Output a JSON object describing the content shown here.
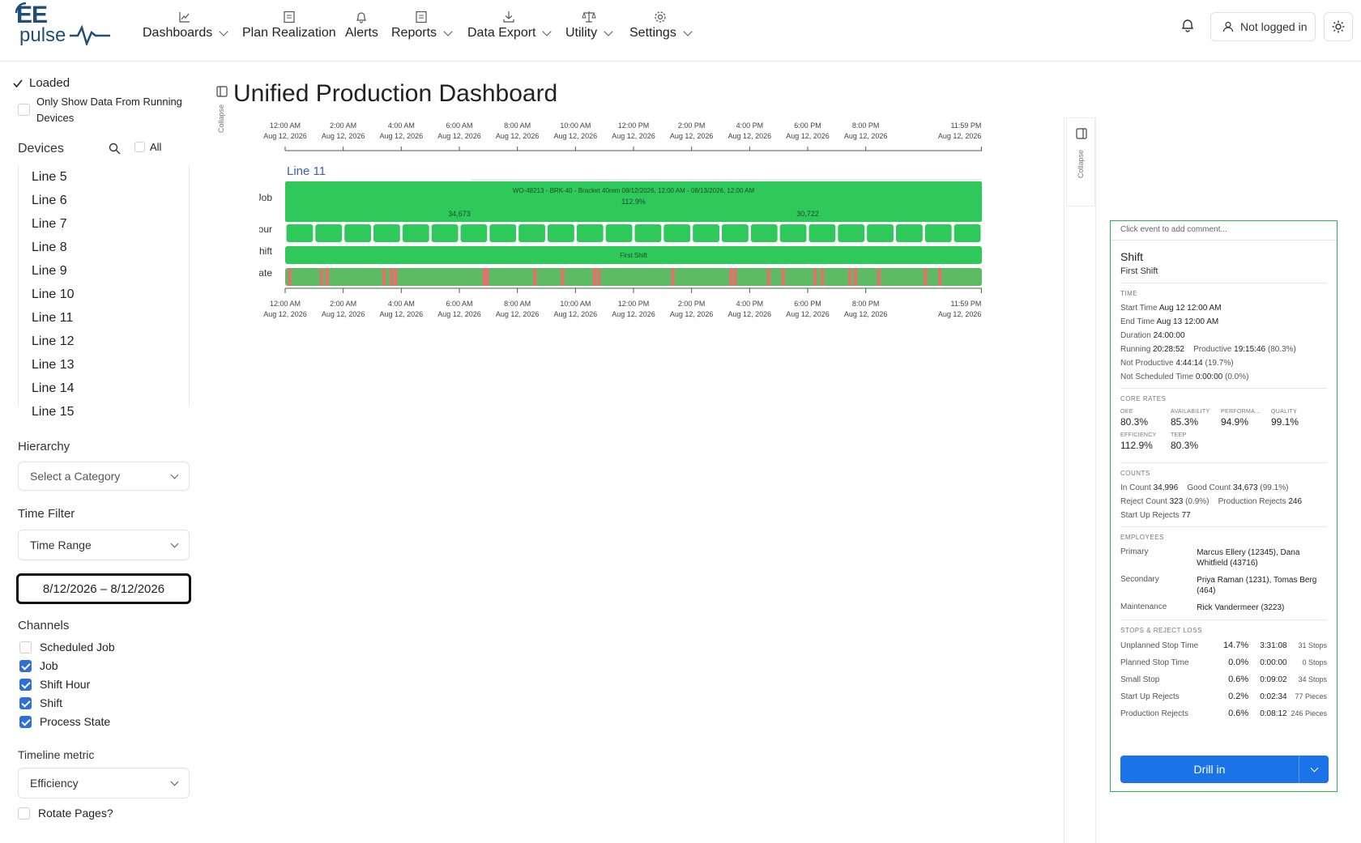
{
  "brand": {
    "line1": "EE",
    "line2": "pulse"
  },
  "nav": {
    "items": [
      {
        "label": "Dashboards",
        "icon": "chart-line-icon",
        "dropdown": true
      },
      {
        "label": "Plan Realization",
        "icon": "document-icon",
        "dropdown": false
      },
      {
        "label": "Alerts",
        "icon": "bell-icon",
        "dropdown": false
      },
      {
        "label": "Reports",
        "icon": "document-icon",
        "dropdown": true
      },
      {
        "label": "Data Export",
        "icon": "download-icon",
        "dropdown": true
      },
      {
        "label": "Utility",
        "icon": "scale-icon",
        "dropdown": true
      },
      {
        "label": "Settings",
        "icon": "gear-icon",
        "dropdown": true
      }
    ],
    "login_label": "Not logged in"
  },
  "sidebar": {
    "loaded_label": "Loaded",
    "running_label": "Only Show Data From Running Devices",
    "devices_title": "Devices",
    "all_label": "All",
    "devices": [
      "Line 5",
      "Line 6",
      "Line 7",
      "Line 8",
      "Line 9",
      "Line 10",
      "Line 11",
      "Line 12",
      "Line 13",
      "Line 14",
      "Line 15"
    ],
    "hierarchy_title": "Hierarchy",
    "hierarchy_placeholder": "Select a Category",
    "time_filter_title": "Time Filter",
    "time_filter_value": "Time Range",
    "date_range": "8/12/2026 – 8/12/2026",
    "channels_title": "Channels",
    "channels": [
      {
        "label": "Scheduled Job",
        "checked": false
      },
      {
        "label": "Job",
        "checked": true
      },
      {
        "label": "Shift Hour",
        "checked": true
      },
      {
        "label": "Shift",
        "checked": true
      },
      {
        "label": "Process State",
        "checked": true
      }
    ],
    "timeline_metric_title": "Timeline metric",
    "timeline_metric_value": "Efficiency",
    "rotate_label": "Rotate Pages?"
  },
  "main": {
    "collapse_label": "Collapse",
    "title": "Unified Production Dashboard"
  },
  "chart_data": {
    "type": "timeline",
    "line_name": "Line 11",
    "tick_times": [
      "12:00 AM",
      "2:00 AM",
      "4:00 AM",
      "6:00 AM",
      "8:00 AM",
      "10:00 AM",
      "12:00 PM",
      "2:00 PM",
      "4:00 PM",
      "6:00 PM",
      "8:00 PM",
      "11:59 PM"
    ],
    "tick_hours": [
      0,
      2,
      4,
      6,
      8,
      10,
      12,
      14,
      16,
      18,
      20,
      23.983
    ],
    "tick_date": "Aug 12, 2026",
    "rows": [
      "Job",
      "Hour",
      "Shift",
      "State"
    ],
    "job": {
      "label": "WO-48213 - BRK-40 - Bracket 40mm   08/12/2026, 12:00 AM - 08/13/2026, 12:00 AM",
      "efficiency": "112.9%",
      "count_left": "34,673",
      "count_right": "30,722",
      "color": "#2ec95a"
    },
    "hour_blocks": 24,
    "shift": {
      "label": "First Shift",
      "color": "#2ec95a"
    },
    "state": {
      "base_color": "#5dbb63",
      "stop_color": "#e8706a",
      "stops_hours": [
        0.1,
        1.2,
        1.4,
        3.35,
        3.6,
        3.75,
        6.8,
        6.9,
        8.55,
        9.5,
        10.6,
        10.75,
        13.3,
        15.3,
        15.45,
        16.6,
        17.1,
        18.2,
        18.45,
        19.4,
        19.6,
        20.4,
        22.0,
        22.5
      ]
    }
  },
  "panel": {
    "comment_placeholder": "Click event to add comment...",
    "title": "Shift",
    "subtitle": "First Shift",
    "time_cap": "TIME",
    "start_time_k": "Start Time",
    "start_time_v": "Aug 12 12:00 AM",
    "end_time_k": "End Time",
    "end_time_v": "Aug 13 12:00 AM",
    "duration_k": "Duration",
    "duration_v": "24:00:00",
    "running_k": "Running",
    "running_v": "20:28:52",
    "productive_k": "Productive",
    "productive_v": "19:15:46",
    "productive_pct": "(80.3%)",
    "not_productive_k": "Not Productive",
    "not_productive_v": "4:44:14",
    "not_productive_pct": "(19.7%)",
    "not_scheduled_k": "Not Scheduled Time",
    "not_scheduled_v": "0:00:00",
    "not_scheduled_pct": "(0.0%)",
    "core_cap": "CORE RATES",
    "rates": [
      {
        "label": "OEE",
        "value": "80.3%"
      },
      {
        "label": "AVAILABILITY",
        "value": "85.3%"
      },
      {
        "label": "PERFORMA...",
        "value": "94.9%"
      },
      {
        "label": "QUALITY",
        "value": "99.1%"
      },
      {
        "label": "EFFICIENCY",
        "value": "112.9%"
      },
      {
        "label": "TEEP",
        "value": "80.3%"
      }
    ],
    "counts_cap": "COUNTS",
    "in_count_k": "In Count",
    "in_count_v": "34,996",
    "good_count_k": "Good Count",
    "good_count_v": "34,673",
    "good_count_pct": "(99.1%)",
    "reject_count_k": "Reject Count",
    "reject_count_v": "323",
    "reject_count_pct": "(0.9%)",
    "prod_rejects_k": "Production Rejects",
    "prod_rejects_v": "246",
    "startup_rejects_k": "Start Up Rejects",
    "startup_rejects_v": "77",
    "employees_cap": "EMPLOYEES",
    "employees": [
      {
        "role": "Primary",
        "names": "Marcus Ellery (12345), Dana Whitfield (43716)"
      },
      {
        "role": "Secondary",
        "names": "Priya Raman (1231), Tomas Berg (464)"
      },
      {
        "role": "Maintenance",
        "names": "Rick Vandermeer (3223)"
      }
    ],
    "stops_cap": "STOPS & REJECT LOSS",
    "stops": [
      {
        "name": "Unplanned Stop Time",
        "pct": "14.7%",
        "time": "3:31:08",
        "count": "31 Stops"
      },
      {
        "name": "Planned Stop Time",
        "pct": "0.0%",
        "time": "0:00:00",
        "count": "0 Stops"
      },
      {
        "name": "Small Stop",
        "pct": "0.6%",
        "time": "0:09:02",
        "count": "34 Stops"
      },
      {
        "name": "Start Up Rejects",
        "pct": "0.2%",
        "time": "0:02:34",
        "count": "77 Pieces"
      },
      {
        "name": "Production Rejects",
        "pct": "0.6%",
        "time": "0:08:12",
        "count": "246 Pieces"
      }
    ],
    "drill_label": "Drill in"
  }
}
